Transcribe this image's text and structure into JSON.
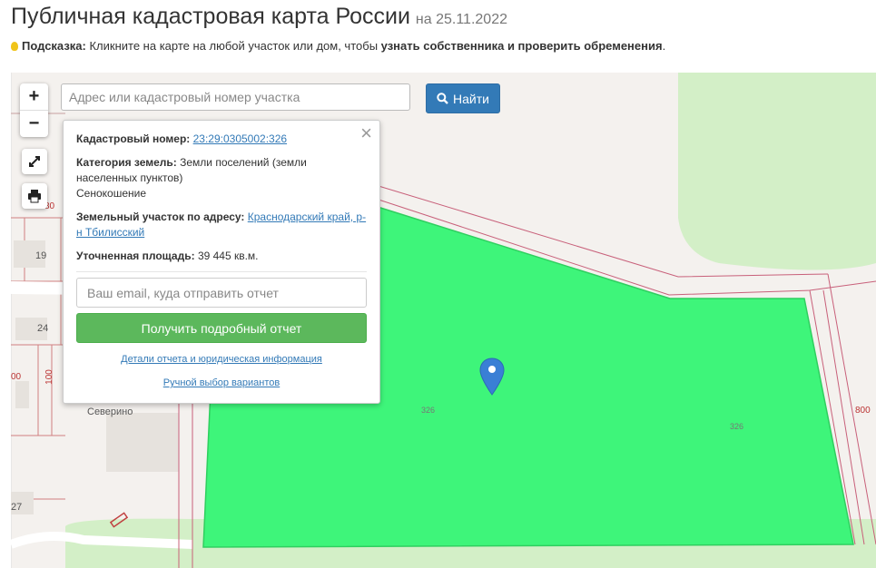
{
  "header": {
    "title": "Публичная кадастровая карта России",
    "date": "на 25.11.2022"
  },
  "hint": {
    "prefix": "Подсказка:",
    "text": " Кликните на карте на любой участок или дом, чтобы ",
    "bold_text": "узнать собственника и проверить обременения",
    "suffix": "."
  },
  "search": {
    "placeholder": "Адрес или кадастровый номер участка",
    "button_label": "Найти"
  },
  "zoom": {
    "in_label": "+",
    "out_label": "−"
  },
  "popup": {
    "close_label": "×",
    "cadastral_label": "Кадастровый номер:",
    "cadastral_value": "23:29:0305002:326",
    "category_label": "Категория земель:",
    "category_value": "Земли поселений (земли населенных пунктов)",
    "category_use": "Сенокошение",
    "address_label": "Земельный участок по адресу:",
    "address_value": "Краснодарский край, р-н Тбилисский",
    "area_label": "Уточненная площадь:",
    "area_value": "39 445 кв.м.",
    "email_placeholder": "Ваш email, куда отправить отчет",
    "report_button": "Получить подробный отчет",
    "details_link": "Детали отчета и юридическая информация",
    "manual_link": "Ручной выбор вариантов"
  },
  "map": {
    "place_label": "Северино",
    "numbers": [
      "80",
      "19",
      "24",
      "00",
      "100",
      "27",
      "326",
      "326",
      "800"
    ]
  },
  "colors": {
    "parcel_fill": "#3ef57a",
    "green_area": "#d3efc7",
    "link": "#337ab7",
    "search_button": "#337ab7",
    "report_button": "#5cb85c"
  }
}
